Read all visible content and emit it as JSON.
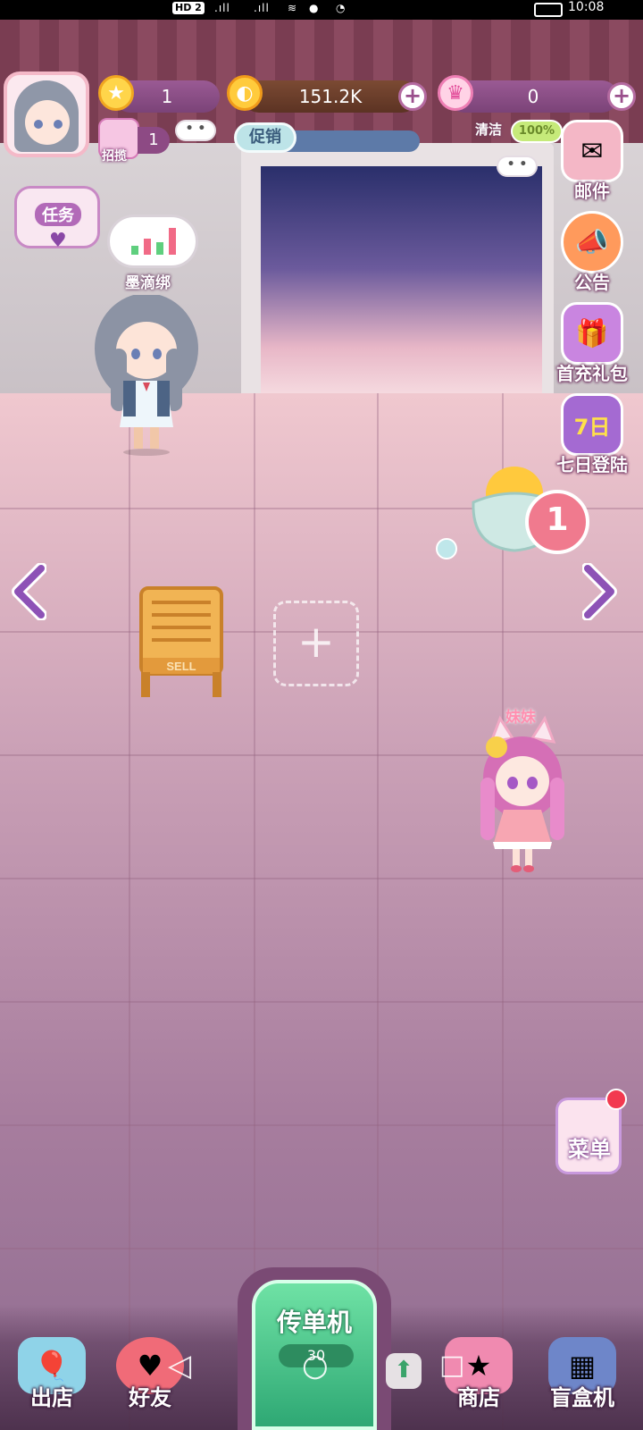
{
  "status_bar": {
    "hd": "HD 2",
    "time": "10:08"
  },
  "hud": {
    "stars": "1",
    "coins": "151.2K",
    "gems": "0",
    "recruit_count": "1",
    "recruit_label": "招揽",
    "promo_label": "促销",
    "clean_label": "清洁",
    "clean_value": "100%"
  },
  "side_buttons": {
    "mail": "邮件",
    "notice": "公告",
    "first_pack": "首充礼包",
    "seven_day": "七日登陆",
    "seven_day_badge": "7日"
  },
  "task_label": "任务",
  "characters": {
    "shop_owner_name": "墨滴绑",
    "sister_name": "妹妹"
  },
  "sell_board_label": "SELL",
  "alert_count": "1",
  "menu_label": "菜单",
  "bottom_nav": {
    "leave": "出店",
    "friends": "好友",
    "flyer": "传单机",
    "flyer_count": "30",
    "shop": "商店",
    "blindbox": "盲盒机"
  },
  "colors": {
    "floor_top": "#f0c8cf",
    "wall_stripe": "#7a3d52",
    "accent_green": "#2ea874",
    "hud_pill": "#8d4a84"
  }
}
